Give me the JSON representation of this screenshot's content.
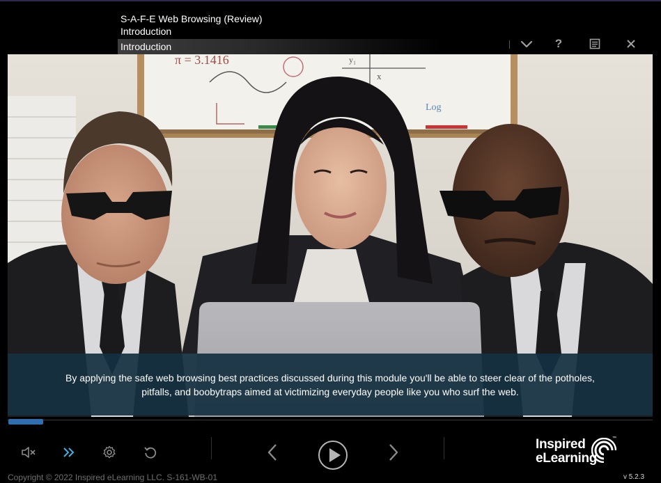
{
  "header": {
    "course_title": "S-A-F-E Web Browsing (Review)",
    "section": "Introduction",
    "menu_label": "Introduction"
  },
  "toolbar": {
    "icons": [
      "chevron-down-icon",
      "help-icon",
      "notes-icon",
      "close-icon"
    ],
    "help_glyph": "?"
  },
  "video": {
    "whiteboard_text": [
      "π = 3.1416",
      "y₁",
      "x",
      "Log"
    ],
    "caption_lines": [
      "By applying the safe web browsing best practices discussed during this module you'll be able to steer clear of the potholes,",
      "pitfalls, and boobytraps aimed at victimizing everyday people like you who surf the web."
    ]
  },
  "progress": {
    "value_percent": 5.4
  },
  "controls": {
    "left": [
      "mute-icon",
      "fast-forward-icon",
      "settings-icon",
      "replay-icon"
    ],
    "center": [
      "previous-icon",
      "play-icon",
      "next-icon"
    ],
    "accent": "#3ab4e6"
  },
  "branding": {
    "logo_line1": "Inspired",
    "logo_line2": "eLearning",
    "trademark": "™"
  },
  "footer": {
    "copyright": "Copyright © 2022 Inspired eLearning LLC. S-161-WB-01",
    "version": "v 5.2.3"
  }
}
